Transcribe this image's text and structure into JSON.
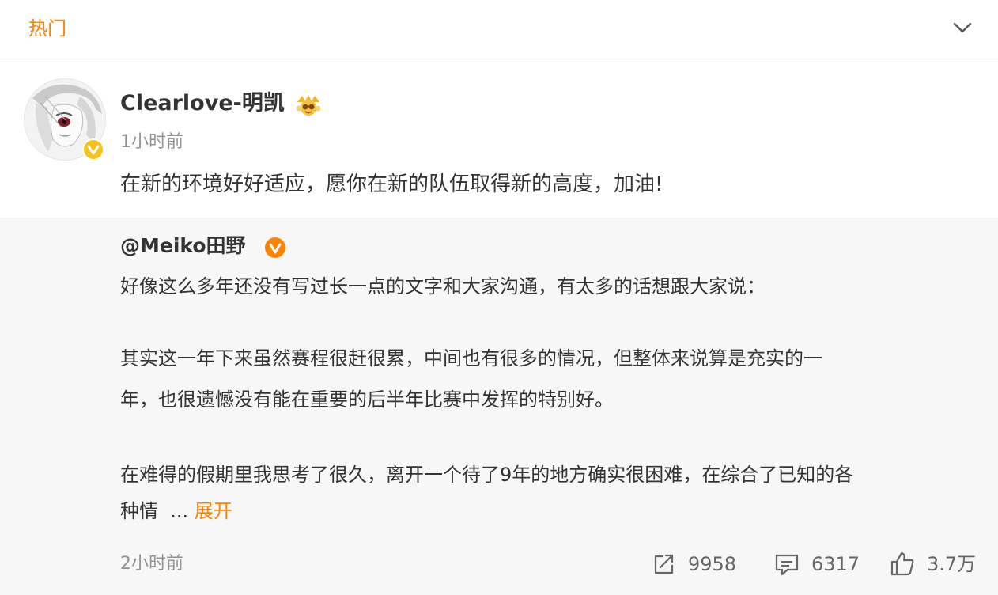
{
  "header": {
    "tab_label": "热门"
  },
  "post": {
    "username": "Clearlove-明凯",
    "time": "1小时前",
    "text": "在新的环境好好适应，愿你在新的队伍取得新的高度，加油!"
  },
  "repost": {
    "author": "@Meiko田野",
    "lines": [
      "好像这么多年还没有写过长一点的文字和大家沟通，有太多的话想跟大家说：",
      "其实这一年下来虽然赛程很赶很累，中间也有很多的情况，但整体来说算是充实的一",
      "年，也很遗憾没有能在重要的后半年比赛中发挥的特别好。",
      "在难得的假期里我思考了很久，离开一个待了9年的地方确实很困难，在综合了已知的各",
      "种情"
    ],
    "ellipsis": "...",
    "expand_label": "展开",
    "time": "2小时前",
    "actions": {
      "share_count": "9958",
      "comment_count": "6317",
      "like_count": "3.7万"
    }
  },
  "colors": {
    "accent": "#ff8200",
    "verified_gold": "#f7c21c",
    "muted_text": "#939393",
    "repost_bg": "#f7f7f7"
  },
  "icons": {
    "collapse": "chevron-down-icon",
    "verified": "verified-badge-icon",
    "member": "vip-member-icon",
    "share": "share-icon",
    "comment": "comment-icon",
    "like": "thumbs-up-icon"
  }
}
